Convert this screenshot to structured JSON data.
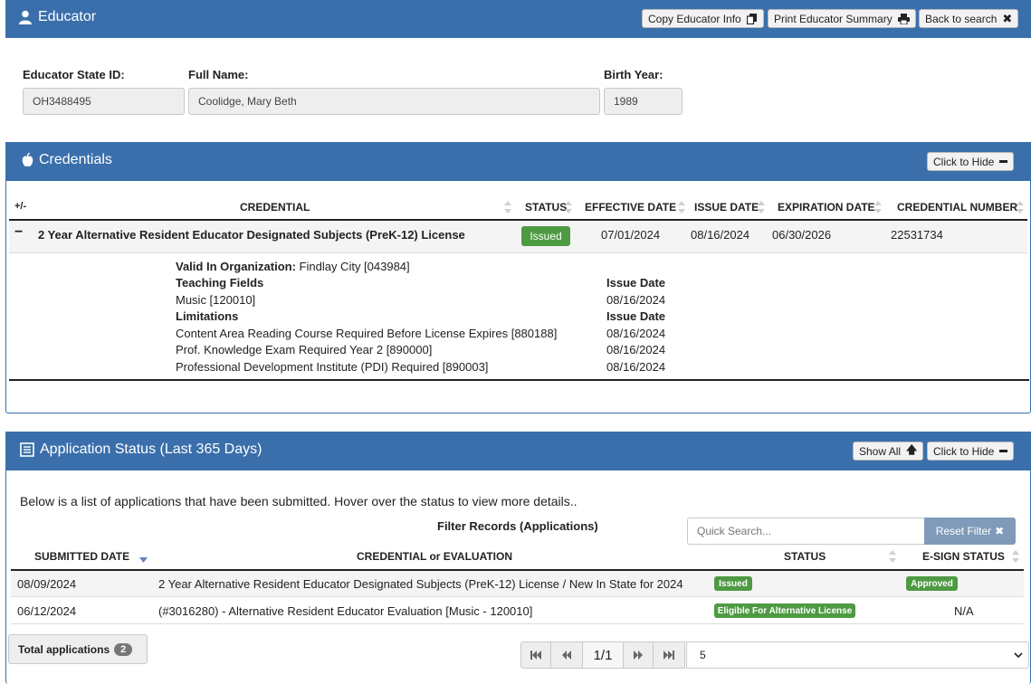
{
  "educator": {
    "title": "Educator",
    "buttons": {
      "copy": "Copy Educator Info",
      "print": "Print Educator Summary",
      "back": "Back to search"
    },
    "labels": {
      "state_id": "Educator State ID:",
      "full_name": "Full Name:",
      "birth_year": "Birth Year:"
    },
    "values": {
      "state_id": "OH3488495",
      "full_name": "Coolidge, Mary Beth",
      "birth_year": "1989"
    }
  },
  "credentials": {
    "title": "Credentials",
    "hide_button": "Click to Hide",
    "expand_all": "+/-",
    "columns": [
      "CREDENTIAL",
      "STATUS",
      "EFFECTIVE DATE",
      "ISSUE DATE",
      "EXPIRATION DATE",
      "CREDENTIAL NUMBER"
    ],
    "row": {
      "toggle": "−",
      "name": "2 Year Alternative Resident Educator Designated Subjects (PreK-12) License",
      "status": "Issued",
      "effective_date": "07/01/2024",
      "issue_date": "08/16/2024",
      "expiration_date": "06/30/2026",
      "credential_number": "22531734"
    },
    "detail": {
      "valid_in_label": "Valid In Organization:",
      "valid_in_value": "Findlay City [043984]",
      "teaching_fields_label": "Teaching Fields",
      "issue_date_label": "Issue Date",
      "teaching_fields": [
        {
          "name": "Music [120010]",
          "date": "08/16/2024"
        }
      ],
      "limitations_label": "Limitations",
      "limitations": [
        {
          "name": "Content Area Reading Course Required Before License Expires [880188]",
          "date": "08/16/2024"
        },
        {
          "name": "Prof. Knowledge Exam Required Year 2 [890000]",
          "date": "08/16/2024"
        },
        {
          "name": "Professional Development Institute (PDI) Required [890003]",
          "date": "08/16/2024"
        }
      ]
    }
  },
  "applications": {
    "title": "Application Status (Last 365 Days)",
    "show_all": "Show All",
    "hide_button": "Click to Hide",
    "intro": "Below is a list of applications that have been submitted. Hover over the status to view more details..",
    "filter_title": "Filter Records (Applications)",
    "search_placeholder": "Quick Search...",
    "reset_filter": "Reset Filter",
    "columns": [
      "SUBMITTED DATE",
      "CREDENTIAL or EVALUATION",
      "STATUS",
      "E-SIGN STATUS"
    ],
    "rows": [
      {
        "date": "08/09/2024",
        "item": "2 Year Alternative Resident Educator Designated Subjects (PreK-12) License / New In State for 2024",
        "status": "Issued",
        "esign": "Approved"
      },
      {
        "date": "06/12/2024",
        "item": "(#3016280) - Alternative Resident Educator Evaluation [Music - 120010]",
        "status": "Eligible For Alternative License",
        "esign": "N/A"
      }
    ],
    "total_label": "Total applications",
    "total_count": "2",
    "page": "1/1",
    "page_size": "5"
  }
}
